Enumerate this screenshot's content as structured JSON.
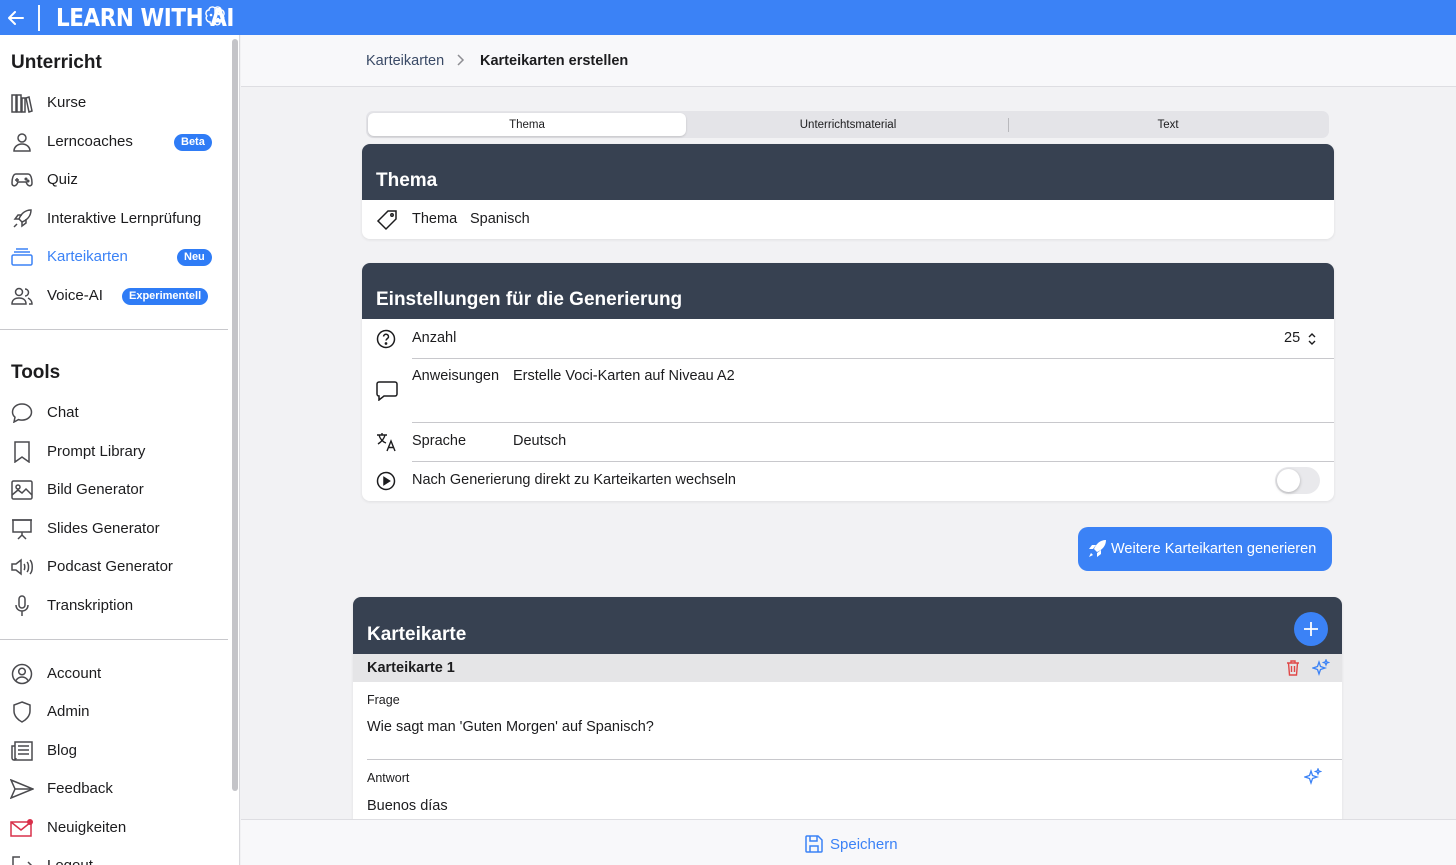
{
  "app": {
    "brand": "LEARN WITH AI",
    "accent": "#3b82f6",
    "header_dark": "#374151"
  },
  "sidebar": {
    "section_unterricht": "Unterricht",
    "unterricht_items": [
      {
        "label": "Kurse",
        "icon": "books-icon"
      },
      {
        "label": "Lerncoaches",
        "icon": "person-icon",
        "badge": "Beta"
      },
      {
        "label": "Quiz",
        "icon": "gamepad-icon"
      },
      {
        "label": "Interaktive Lernprüfung",
        "icon": "rocket-icon"
      },
      {
        "label": "Karteikarten",
        "icon": "cards-stack-icon",
        "badge": "Neu",
        "active": true
      },
      {
        "label": "Voice-AI",
        "icon": "people-icon",
        "badge": "Experimentell"
      }
    ],
    "section_tools": "Tools",
    "tools_items": [
      {
        "label": "Chat",
        "icon": "chat-bubble-icon"
      },
      {
        "label": "Prompt Library",
        "icon": "bookmark-icon"
      },
      {
        "label": "Bild Generator",
        "icon": "image-icon"
      },
      {
        "label": "Slides Generator",
        "icon": "presentation-icon"
      },
      {
        "label": "Podcast Generator",
        "icon": "speaker-icon"
      },
      {
        "label": "Transkription",
        "icon": "microphone-icon"
      }
    ],
    "account_items": [
      {
        "label": "Account",
        "icon": "user-circle-icon"
      },
      {
        "label": "Admin",
        "icon": "shield-icon"
      },
      {
        "label": "Blog",
        "icon": "newspaper-icon"
      },
      {
        "label": "Feedback",
        "icon": "send-icon"
      },
      {
        "label": "Neuigkeiten",
        "icon": "mail-icon"
      },
      {
        "label": "Logout",
        "icon": "logout-icon"
      }
    ]
  },
  "breadcrumb": {
    "parent": "Karteikarten",
    "current": "Karteikarten erstellen"
  },
  "tabs": [
    "Thema",
    "Unterrichtsmaterial",
    "Text"
  ],
  "thema_card": {
    "title": "Thema",
    "field_label": "Thema",
    "field_value": "Spanisch"
  },
  "settings_card": {
    "title": "Einstellungen für die Generierung",
    "anzahl_label": "Anzahl",
    "anzahl_value": "25",
    "anweisungen_label": "Anweisungen",
    "anweisungen_value": "Erstelle Voci-Karten auf Niveau A2",
    "sprache_label": "Sprache",
    "sprache_value": "Deutsch",
    "switch_label": "Nach Generierung direkt zu Karteikarten wechseln"
  },
  "generate_button": "Weitere Karteikarten generieren",
  "karteikarte_card": {
    "title": "Karteikarte",
    "item_title": "Karteikarte 1",
    "frage_label": "Frage",
    "frage_value": "Wie sagt man 'Guten Morgen' auf Spanisch?",
    "antwort_label": "Antwort",
    "antwort_value": "Buenos días"
  },
  "footer": {
    "save_label": "Speichern"
  }
}
